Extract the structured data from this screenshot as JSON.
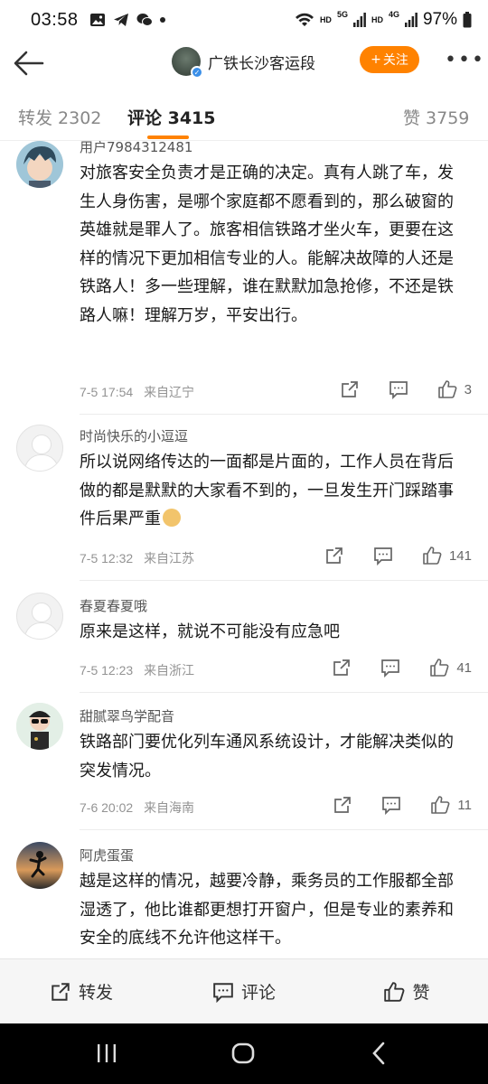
{
  "status": {
    "time": "03:58",
    "battery": "97%",
    "net1": "HD",
    "net1_sup": "5G",
    "net2": "HD",
    "net2_sup": "4G"
  },
  "header": {
    "account_name": "广铁长沙客运段",
    "follow_label": "关注"
  },
  "tabs": {
    "repost": "转发 2302",
    "comments": "评论 3415",
    "likes": "赞 3759"
  },
  "comments": [
    {
      "user": "用户7984312481",
      "text": "对旅客安全负责才是正确的决定。真有人跳了车，发生人身伤害，是哪个家庭都不愿看到的，那么破窗的英雄就是罪人了。旅客相信铁路才坐火车，更要在这样的情况下更加相信专业的人。能解决故障的人还是铁路人！多一些理解，谁在默默加急抢修，不还是铁路人嘛！理解万岁，平安出行。",
      "time": "7-5 17:54",
      "location": "来自辽宁",
      "likes": "3"
    },
    {
      "user": "时尚快乐的小逗逗",
      "text": "所以说网络传达的一面都是片面的，工作人员在背后做的都是默默的大家看不到的，一旦发生开门踩踏事件后果严重",
      "time": "7-5 12:32",
      "location": "来自江苏",
      "likes": "141"
    },
    {
      "user": "春夏春夏哦",
      "text": "原来是这样，就说不可能没有应急吧",
      "time": "7-5 12:23",
      "location": "来自浙江",
      "likes": "41"
    },
    {
      "user": "甜腻翠鸟学配音",
      "text": "铁路部门要优化列车通风系统设计，才能解决类似的突发情况。",
      "time": "7-6 20:02",
      "location": "来自海南",
      "likes": "11"
    },
    {
      "user": "阿虎蛋蛋",
      "text": "越是这样的情况，越要冷静，乘务员的工作服都全部湿透了，他比谁都更想打开窗户，但是专业的素养和安全的底线不允许他这样干。"
    }
  ],
  "bottombar": {
    "repost": "转发",
    "comment": "评论",
    "like": "赞"
  },
  "colors": {
    "accent": "#ff8200",
    "meta": "#939393"
  }
}
